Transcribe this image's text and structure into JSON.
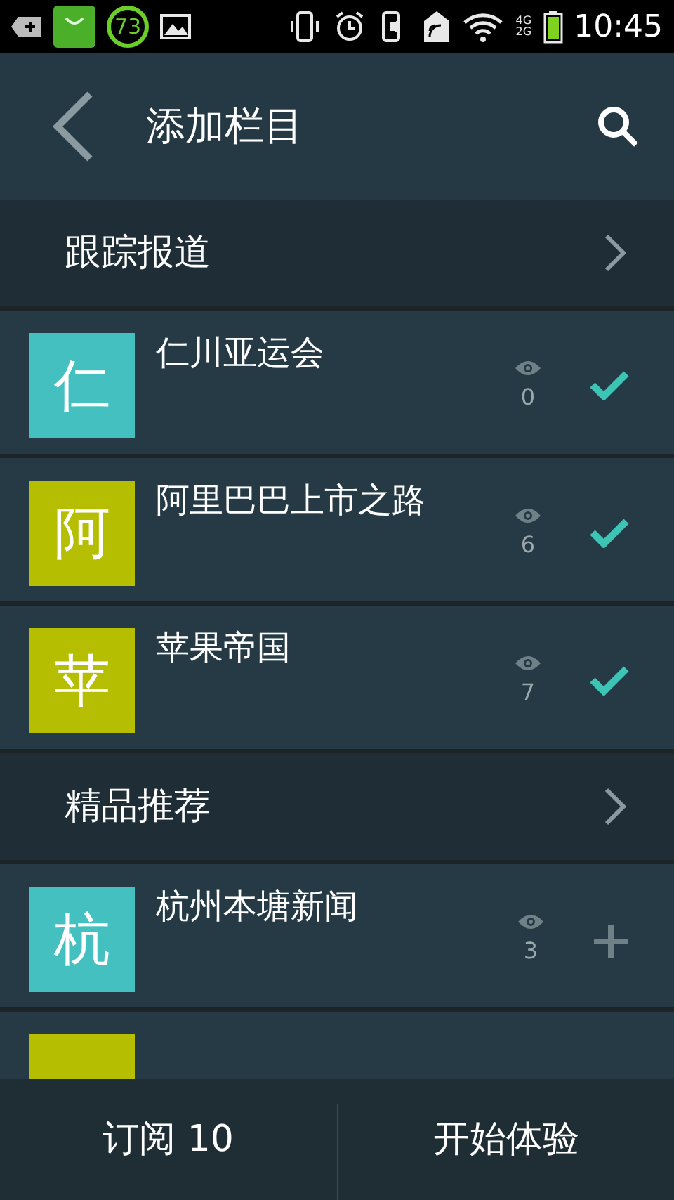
{
  "status_bar": {
    "badge": "73",
    "network_top": "4G",
    "network_bottom": "2G",
    "time": "10:45"
  },
  "header": {
    "title": "添加栏目"
  },
  "sections": [
    {
      "title": "跟踪报道",
      "items": [
        {
          "letter": "仁",
          "name": "仁川亚运会",
          "views": "0",
          "subscribed": true,
          "color": "#45c0c0"
        },
        {
          "letter": "阿",
          "name": "阿里巴巴上市之路",
          "views": "6",
          "subscribed": true,
          "color": "#b5be00"
        },
        {
          "letter": "苹",
          "name": "苹果帝国",
          "views": "7",
          "subscribed": true,
          "color": "#b5be00"
        }
      ]
    },
    {
      "title": "精品推荐",
      "items": [
        {
          "letter": "杭",
          "name": "杭州本塘新闻",
          "views": "3",
          "subscribed": false,
          "color": "#45c0c0"
        }
      ]
    }
  ],
  "partial_row": {
    "color": "#b5be00"
  },
  "bottom_bar": {
    "subscribe_label": "订阅 10",
    "start_label": "开始体验"
  }
}
